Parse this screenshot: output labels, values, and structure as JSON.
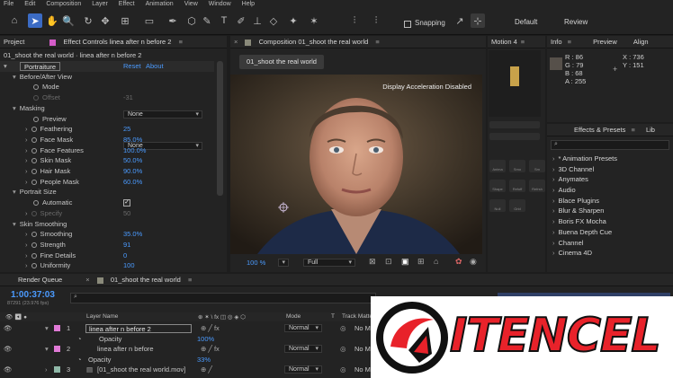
{
  "menu": [
    "File",
    "Edit",
    "Composition",
    "Layer",
    "Effect",
    "Animation",
    "View",
    "Window",
    "Help"
  ],
  "toolbar": {
    "snapping_label": "Snapping",
    "workspaces": [
      "Default",
      "Review"
    ]
  },
  "project_panel": {
    "tab_project": "Project",
    "tab_effect_controls": "Effect Controls linea after n before 2",
    "subtitle": "01_shoot the real world · linea after n before 2",
    "effect_name": "Portraiture",
    "reset": "Reset",
    "about": "About",
    "rows": {
      "before_after_view": "Before/After View",
      "mode": "Mode",
      "mode_value": "None",
      "offset": "Offset",
      "offset_value": "-31",
      "masking": "Masking",
      "preview": "Preview",
      "preview_value": "None",
      "feathering": "Feathering",
      "feathering_value": "25",
      "face_mask": "Face Mask",
      "face_mask_value": "85.0%",
      "face_features": "Face Features",
      "face_features_value": "100.0%",
      "skin_mask": "Skin Mask",
      "skin_mask_value": "50.0%",
      "hair_mask": "Hair Mask",
      "hair_mask_value": "90.0%",
      "people_mask": "People Mask",
      "people_mask_value": "60.0%",
      "portrait_size": "Portrait Size",
      "automatic": "Automatic",
      "specify": "Specify",
      "specify_value": "50",
      "skin_smoothing": "Skin Smoothing",
      "smoothing": "Smoothing",
      "smoothing_value": "35.0%",
      "strength": "Strength",
      "strength_value": "91",
      "fine_details": "Fine Details",
      "fine_details_value": "0",
      "uniformity": "Uniformity",
      "uniformity_value": "100"
    }
  },
  "composition": {
    "tab": "Composition 01_shoot the real world",
    "chip": "01_shoot the real world",
    "overlay": "Display Acceleration Disabled",
    "zoom": "100 %",
    "resolution": "Full"
  },
  "motion_panel": {
    "title": "Motion 4",
    "button_labels": [
      "Anima",
      "Smo",
      "Sm",
      "Shape",
      "Refoff",
      "Refrsh",
      "Null",
      "Grid"
    ]
  },
  "info_panel": {
    "tabs": [
      "Info",
      "Preview",
      "Align"
    ],
    "r": "R : 86",
    "g": "G : 79",
    "b": "B : 68",
    "a": "A : 255",
    "x": "X : 736",
    "y": "Y : 151",
    "swatch_color": "#56504a"
  },
  "effects_presets": {
    "tabs": [
      "Effects & Presets",
      "Lib"
    ],
    "items": [
      "* Animation Presets",
      "3D Channel",
      "Anymates",
      "Audio",
      "Blace Plugins",
      "Blur & Sharpen",
      "Boris FX Mocha",
      "Buena Depth Cue",
      "Channel",
      "Cinema 4D"
    ]
  },
  "timeline": {
    "tab_render": "Render Queue",
    "tab_comp": "01_shoot the real world",
    "timecode": "1:00:37:03",
    "frames": "87291 (23.976 fps)",
    "col_layer": "Layer Name",
    "col_mode": "Mode",
    "col_t": "T",
    "col_track": "Track Matte",
    "layers": [
      {
        "num": "1",
        "name": "linea after n before 2",
        "mode": "Normal",
        "matte": "No M",
        "color": "#e07ad6"
      },
      {
        "num": "",
        "name": "Opacity",
        "value": "100%"
      },
      {
        "num": "2",
        "name": "linea after n before",
        "mode": "Normal",
        "matte": "No M",
        "color": "#e07ad6"
      },
      {
        "num": "",
        "name": "Opacity",
        "value": "33%"
      },
      {
        "num": "3",
        "name": "[01_shoot the real world.mov]",
        "mode": "Normal",
        "matte": "No M",
        "color": "#8fb8a8"
      }
    ]
  },
  "logo": {
    "text": "ITENCEL",
    "brand_color": "#e8222a"
  }
}
